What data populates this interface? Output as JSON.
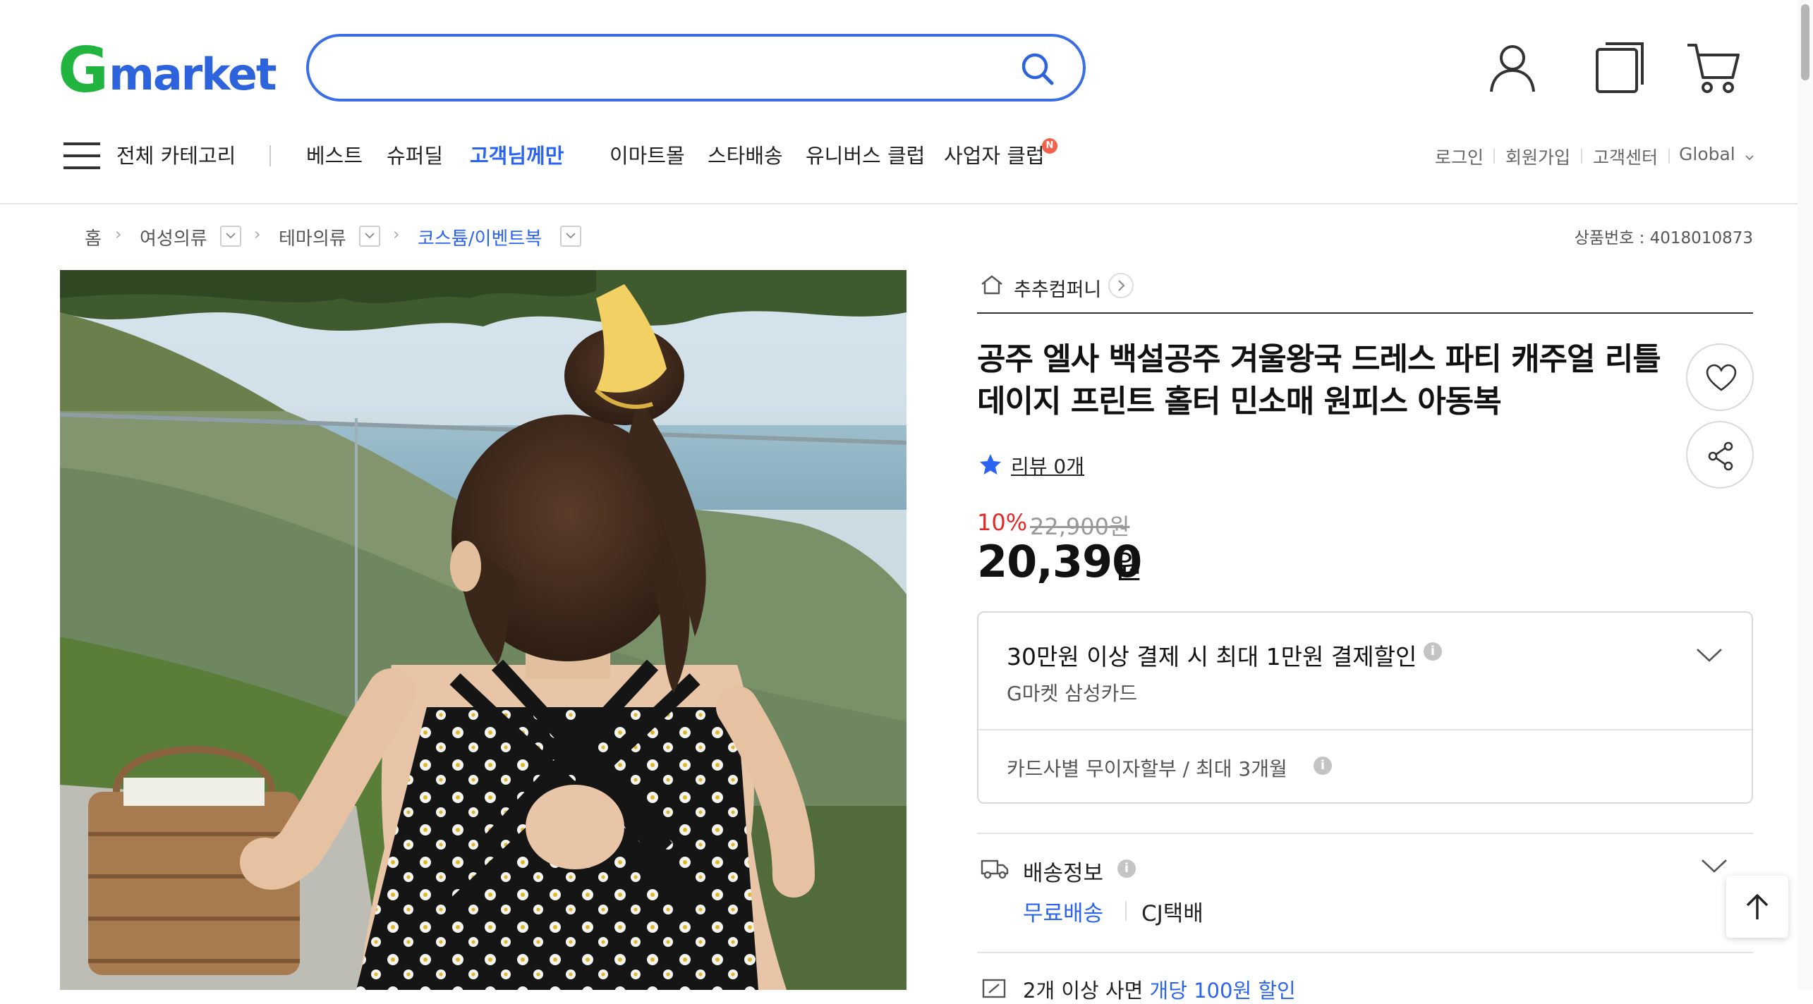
{
  "header": {
    "logo_g": "G",
    "logo_rest": "market",
    "search_value": "",
    "icons": [
      "search-icon",
      "user-icon",
      "recent-items-icon",
      "cart-icon"
    ],
    "colors": {
      "logo_green": "#21b53f",
      "logo_blue": "#2d63dc",
      "search_border": "#3a6ee6",
      "highlight": "#2a64f0"
    }
  },
  "gnb": {
    "all_categories": "전체 카테고리",
    "items": [
      "베스트",
      "슈퍼딜",
      "고객님께만",
      "이마트몰",
      "스타배송",
      "유니버스 클럽",
      "사업자 클럽"
    ],
    "new_badge": "N",
    "util": [
      "로그인",
      "회원가입",
      "고객센터",
      "Global"
    ]
  },
  "breadcrumb": {
    "items": [
      "홈",
      "여성의류",
      "테마의류",
      "코스튬/이벤트복"
    ],
    "product_number": "상품번호 : 4018010873"
  },
  "product": {
    "seller": "추추컴퍼니",
    "title": "공주 엘사 백설공주 겨울왕국 드레스 파티 캐주얼 리틀 데이지 프린트 홀터 민소매 원피스 아동복",
    "review_link": "리뷰 0개",
    "discount_rate": "10%",
    "original_price": "22,900원",
    "price": "20,390",
    "price_unit": "원"
  },
  "benefit": {
    "title": "30만원 이상 결제 시 최대 1만원 결제할인",
    "card": "G마켓 삼성카드",
    "installment": "카드사별 무이자할부 / 최대 3개월",
    "info_icon_text": "i"
  },
  "shipping": {
    "label": "배송정보",
    "free": "무료배송",
    "carrier": "CJ택배",
    "multi_prefix": "2개 이상 사면 ",
    "multi_discount": "개당 100원 할인"
  }
}
